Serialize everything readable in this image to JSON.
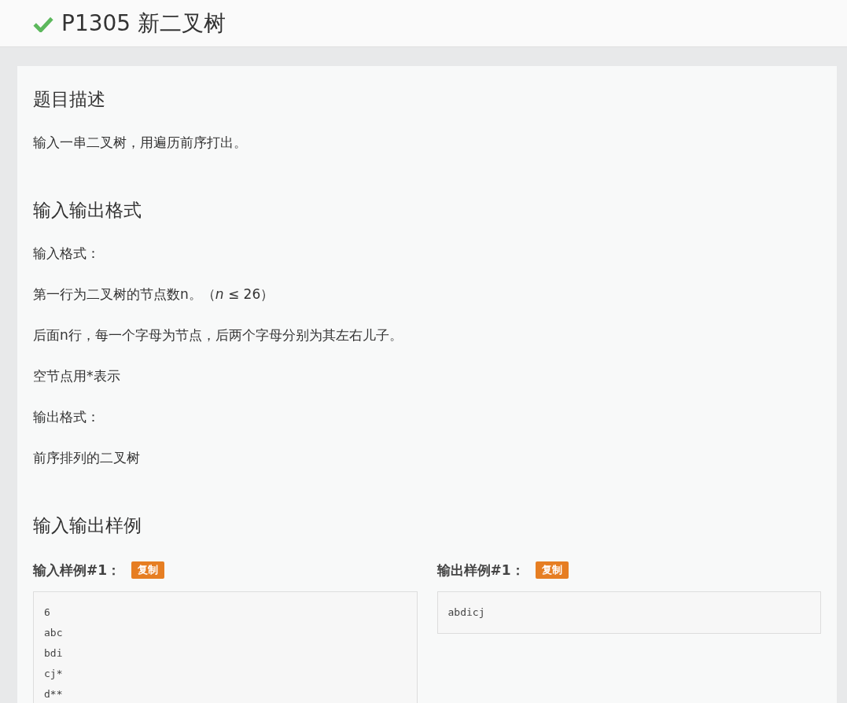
{
  "header": {
    "solved": true,
    "title": "P1305 新二叉树"
  },
  "sections": [
    {
      "heading": "题目描述",
      "paragraphs": [
        "输入一串二叉树，用遍历前序打出。"
      ]
    },
    {
      "heading": "输入输出格式",
      "paragraphs": [
        "输入格式：",
        "第一行为二叉树的节点数n。（*n* ≤ 26）",
        "后面n行，每一个字母为节点，后两个字母分别为其左右儿子。",
        "空节点用*表示",
        "输出格式：",
        "前序排列的二叉树"
      ]
    },
    {
      "heading": "输入输出样例"
    }
  ],
  "samples": [
    {
      "label": "输入样例#1：",
      "copy_button": "复制",
      "lines": [
        "6",
        "abc",
        "bdi",
        "cj*",
        "d**"
      ]
    },
    {
      "label": "输出样例#1：",
      "copy_button": "复制",
      "lines": [
        "abdicj"
      ]
    }
  ]
}
